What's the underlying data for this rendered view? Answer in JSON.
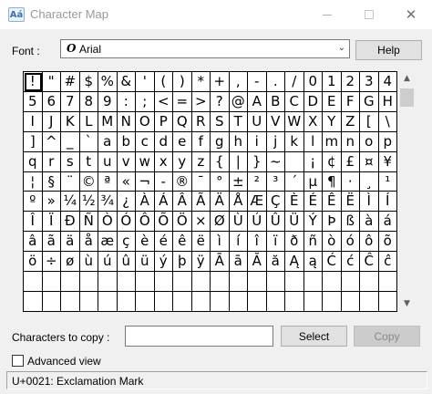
{
  "window": {
    "title": "Character Map",
    "app_icon": "character-map-icon",
    "minimize_icon": "minimize-icon",
    "maximize_icon": "maximize-icon",
    "close_icon": "close-icon",
    "close_glyph": "✕"
  },
  "font": {
    "label": "Font :",
    "selected": "Arial",
    "glyph": "O",
    "dropdown_icon": "chevron-down-icon",
    "dropdown_glyph": "⌄"
  },
  "help_label": "Help",
  "grid": {
    "rows": [
      [
        "!",
        "\"",
        "#",
        "$",
        "%",
        "&",
        "'",
        "(",
        ")",
        "*",
        "+",
        ",",
        "-",
        ".",
        "/",
        "0",
        "1",
        "2",
        "3",
        "4"
      ],
      [
        "5",
        "6",
        "7",
        "8",
        "9",
        ":",
        ";",
        "<",
        "=",
        ">",
        "?",
        "@",
        "A",
        "B",
        "C",
        "D",
        "E",
        "F",
        "G",
        "H"
      ],
      [
        "I",
        "J",
        "K",
        "L",
        "M",
        "N",
        "O",
        "P",
        "Q",
        "R",
        "S",
        "T",
        "U",
        "V",
        "W",
        "X",
        "Y",
        "Z",
        "[",
        "\\"
      ],
      [
        "]",
        "^",
        "_",
        "`",
        "a",
        "b",
        "c",
        "d",
        "e",
        "f",
        "g",
        "h",
        "i",
        "j",
        "k",
        "l",
        "m",
        "n",
        "o",
        "p"
      ],
      [
        "q",
        "r",
        "s",
        "t",
        "u",
        "v",
        "w",
        "x",
        "y",
        "z",
        "{",
        "|",
        "}",
        "~",
        "",
        "¡",
        "¢",
        "£",
        "¤",
        "¥"
      ],
      [
        "¦",
        "§",
        "¨",
        "©",
        "ª",
        "«",
        "¬",
        "-",
        "®",
        "¯",
        "°",
        "±",
        "²",
        "³",
        "´",
        "µ",
        "¶",
        "·",
        "¸",
        "¹"
      ],
      [
        "º",
        "»",
        "¼",
        "½",
        "¾",
        "¿",
        "À",
        "Á",
        "Â",
        "Ã",
        "Ä",
        "Å",
        "Æ",
        "Ç",
        "È",
        "É",
        "Ê",
        "Ë",
        "Ì",
        "Í"
      ],
      [
        "Î",
        "Ï",
        "Ð",
        "Ñ",
        "Ò",
        "Ó",
        "Ô",
        "Õ",
        "Ö",
        "×",
        "Ø",
        "Ù",
        "Ú",
        "Û",
        "Ü",
        "Ý",
        "Þ",
        "ß",
        "à",
        "á"
      ],
      [
        "â",
        "ã",
        "ä",
        "å",
        "æ",
        "ç",
        "è",
        "é",
        "ê",
        "ë",
        "ì",
        "í",
        "î",
        "ï",
        "ð",
        "ñ",
        "ò",
        "ó",
        "ô",
        "õ"
      ],
      [
        "ö",
        "÷",
        "ø",
        "ù",
        "ú",
        "û",
        "ü",
        "ý",
        "þ",
        "ÿ",
        "Ā",
        "ā",
        "Ă",
        "ă",
        "Ą",
        "ą",
        "Ć",
        "ć",
        "Ĉ",
        "ĉ"
      ]
    ],
    "selected_index": 0
  },
  "scrollbar": {
    "up_icon": "scroll-up-arrow-icon",
    "up_glyph": "▲",
    "down_icon": "scroll-down-arrow-icon",
    "down_glyph": "▼"
  },
  "copy": {
    "label": "Characters to copy :",
    "value": "",
    "select_label": "Select",
    "copy_label": "Copy"
  },
  "advanced_view_label": "Advanced view",
  "status": "U+0021: Exclamation Mark"
}
